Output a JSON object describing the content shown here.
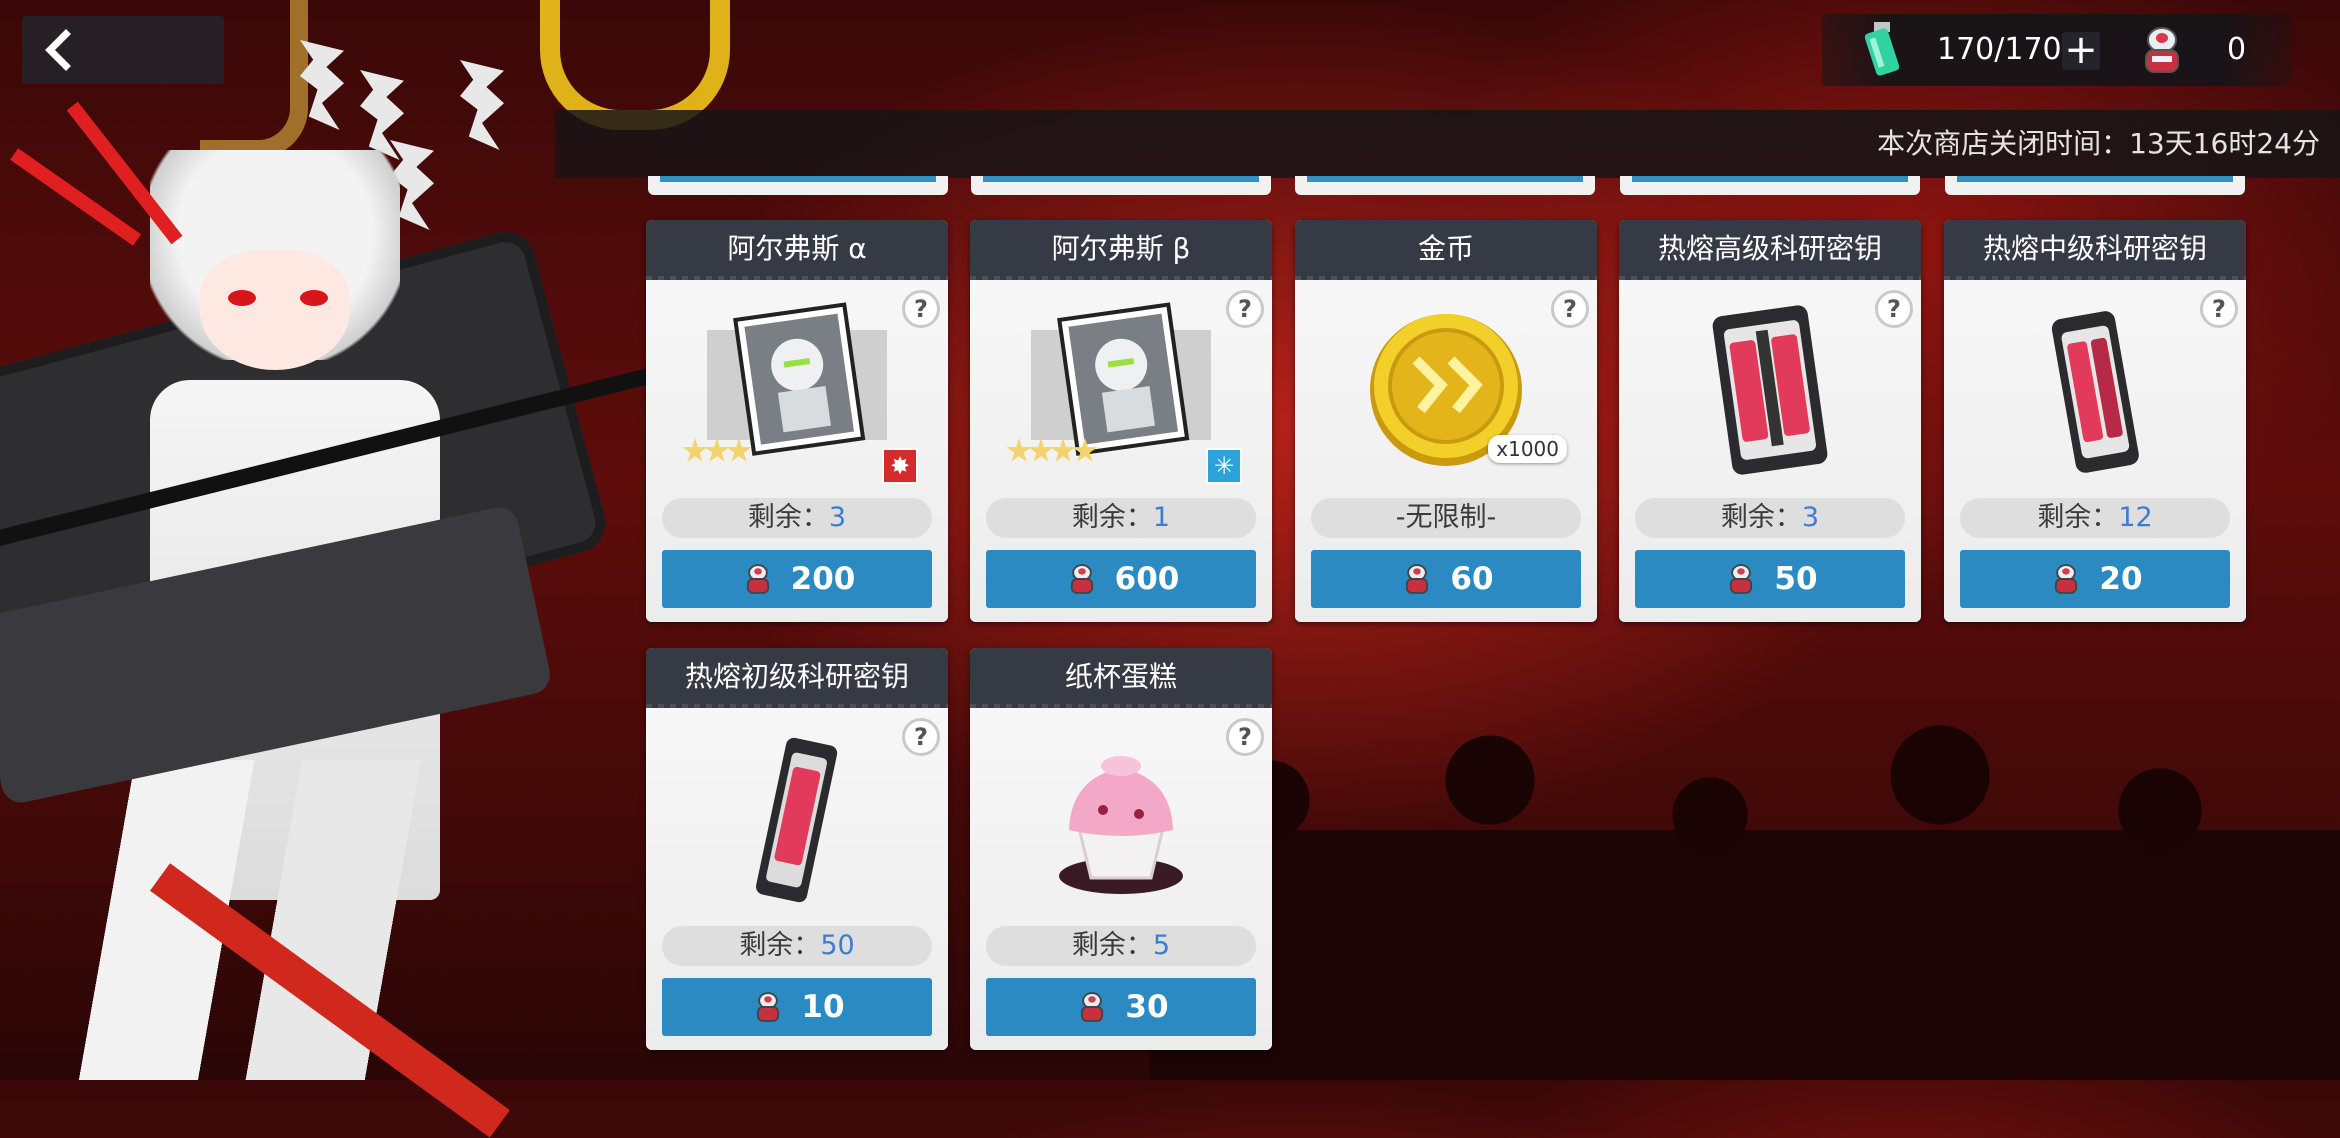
{
  "header": {
    "back_label": "",
    "stamina_value": "170/170",
    "plus_label": "+",
    "currency_value": "0"
  },
  "shop": {
    "closing_time_text": "本次商店关闭时间：13天16时24分"
  },
  "items": [
    {
      "name": "阿尔弗斯 α",
      "remain_label": "剩余：",
      "remain_value": "3",
      "price": "200",
      "icon": "robot-card-icon",
      "stars": 3,
      "attribute_color": "#d52b2b",
      "attribute_glyph": "✸"
    },
    {
      "name": "阿尔弗斯 β",
      "remain_label": "剩余：",
      "remain_value": "1",
      "price": "600",
      "icon": "robot-card-icon",
      "stars": 4,
      "attribute_color": "#2aa3d8",
      "attribute_glyph": "✳"
    },
    {
      "name": "金币",
      "remain_label": "-无限制-",
      "remain_value": "",
      "price": "60",
      "icon": "gold-coin-icon",
      "quantity": "x1000"
    },
    {
      "name": "热熔高级科研密钥",
      "remain_label": "剩余：",
      "remain_value": "3",
      "price": "50",
      "icon": "research-key-advanced-icon"
    },
    {
      "name": "热熔中级科研密钥",
      "remain_label": "剩余：",
      "remain_value": "12",
      "price": "20",
      "icon": "research-key-intermediate-icon"
    },
    {
      "name": "热熔初级科研密钥",
      "remain_label": "剩余：",
      "remain_value": "50",
      "price": "10",
      "icon": "research-key-basic-icon"
    },
    {
      "name": "纸杯蛋糕",
      "remain_label": "剩余：",
      "remain_value": "5",
      "price": "30",
      "icon": "cupcake-icon"
    }
  ],
  "colors": {
    "buy_button": "#2c8ac2",
    "remain_number": "#3a7dd1",
    "card_header": "#363a44"
  }
}
